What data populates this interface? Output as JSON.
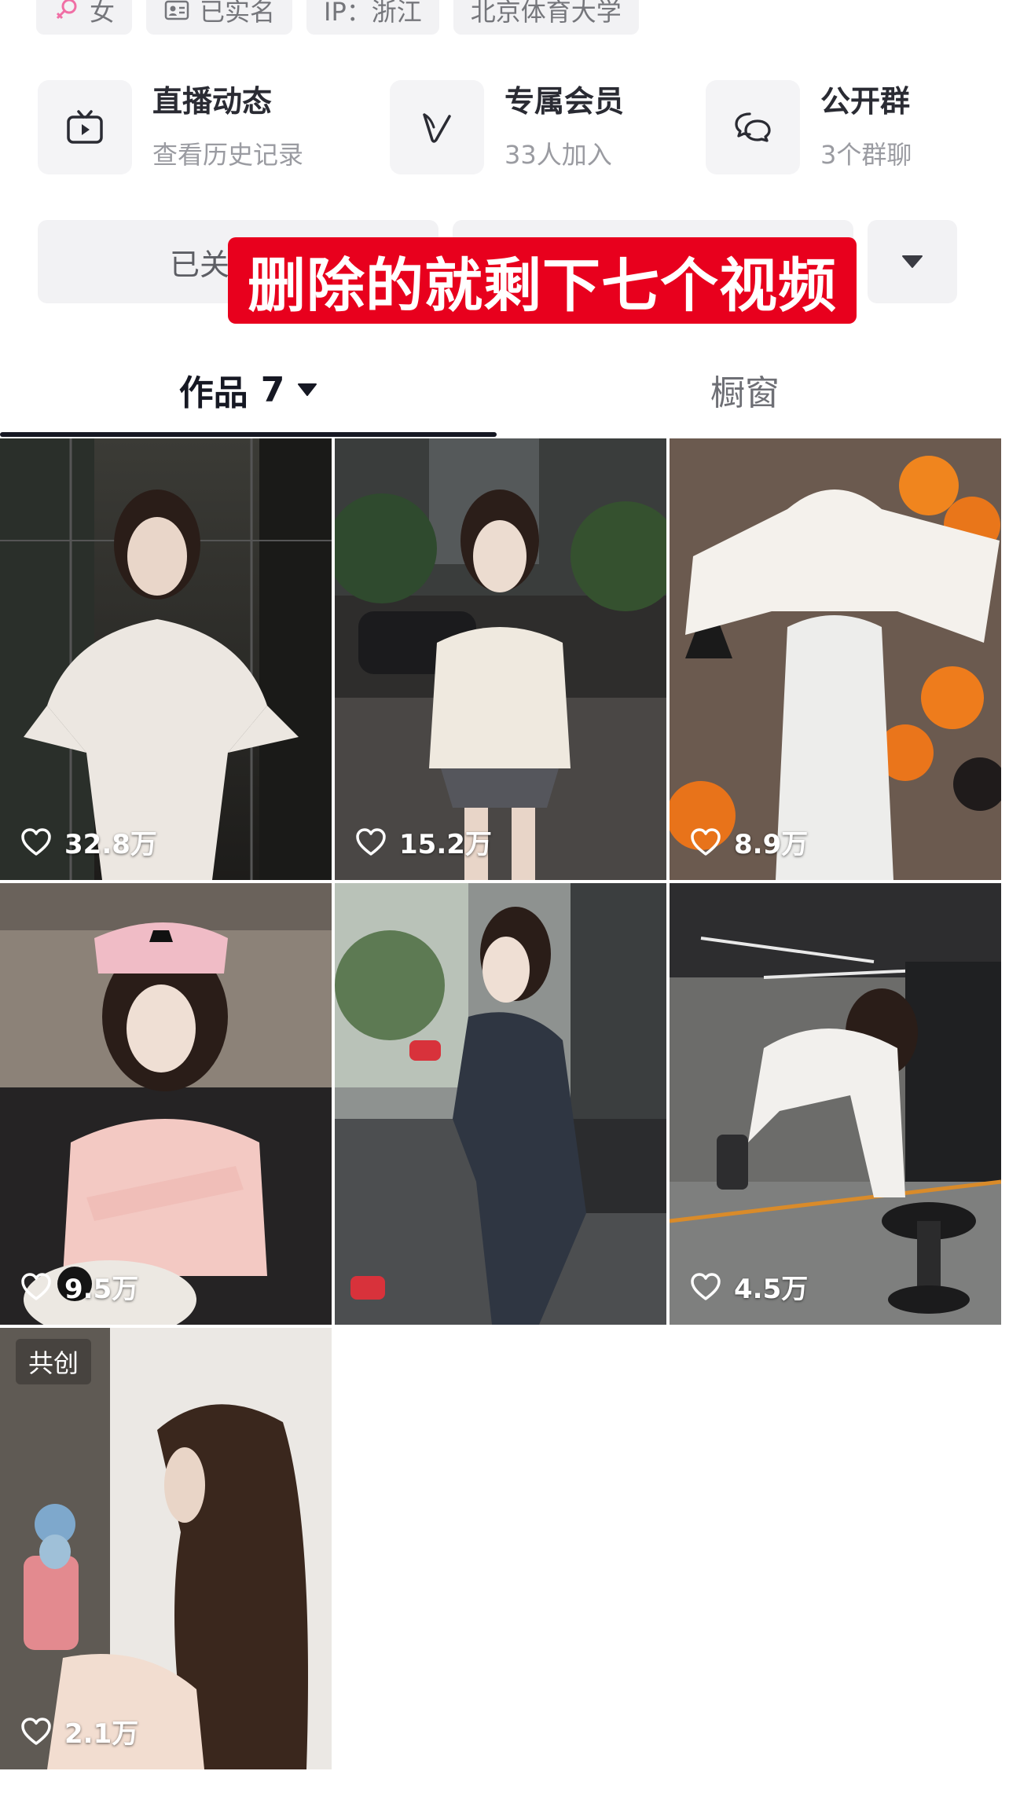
{
  "profile_tags": [
    {
      "icon": "female-icon",
      "label": "女"
    },
    {
      "icon": "id-card-icon",
      "label": "已实名"
    },
    {
      "icon": "",
      "label": "IP：浙江"
    },
    {
      "icon": "",
      "label": "北京体育大学"
    }
  ],
  "features": [
    {
      "icon": "tv-icon",
      "title": "直播动态",
      "sub": "查看历史记录"
    },
    {
      "icon": "vip-icon",
      "title": "专属会员",
      "sub": "33人加入"
    },
    {
      "icon": "chat-bubbles-icon",
      "title": "公开群",
      "sub": "3个群聊"
    }
  ],
  "actions": {
    "follow_label": "已关"
  },
  "overlay_caption": "删除的就剩下七个视频",
  "tabs": {
    "works_label": "作品",
    "works_count": "7",
    "window_label": "橱窗"
  },
  "videos": [
    {
      "likes": "32.8万",
      "badge": ""
    },
    {
      "likes": "15.2万",
      "badge": ""
    },
    {
      "likes": "8.9万",
      "badge": ""
    },
    {
      "likes": "9.5万",
      "badge": ""
    },
    {
      "likes": "",
      "badge": ""
    },
    {
      "likes": "4.5万",
      "badge": ""
    },
    {
      "likes": "2.1万",
      "badge": "共创"
    }
  ],
  "colors": {
    "caption_bg": "#e8001d",
    "text_primary": "#161823",
    "text_secondary": "#9a9ba1",
    "chip_bg": "#f2f2f4"
  }
}
